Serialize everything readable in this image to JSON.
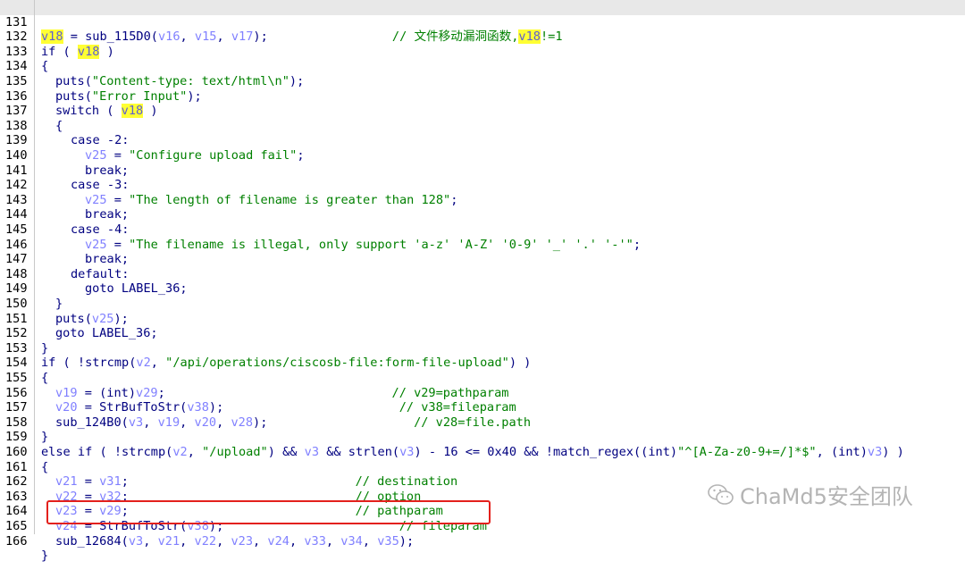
{
  "code": {
    "line_numbers": [
      "131",
      "132",
      "133",
      "134",
      "135",
      "136",
      "137",
      "138",
      "139",
      "140",
      "141",
      "142",
      "143",
      "144",
      "145",
      "146",
      "147",
      "148",
      "149",
      "150",
      "151",
      "152",
      "153",
      "154",
      "155",
      "156",
      "157",
      "158",
      "159",
      "160",
      "161",
      "162",
      "163",
      "164",
      "165",
      "166"
    ],
    "l131": {
      "v18": "v18",
      "assign": " = sub_115D0(",
      "v16": "v16",
      ", ": ", ",
      "v15": "v15",
      "v17": "v17",
      "close": ");",
      "pad": "                 ",
      "comment": "// 文件移动漏洞函数,",
      "v18b": "v18",
      "tail": "!=1"
    },
    "l132": {
      "pre": "if ( ",
      "v18": "v18",
      "post": " )"
    },
    "l133": "{",
    "l134": {
      "pre": "puts(",
      "str": "\"Content-type: text/html\\n\"",
      "post": ");"
    },
    "l135": {
      "pre": "puts(",
      "str": "\"Error Input\"",
      "post": ");"
    },
    "l136": {
      "pre": "switch ( ",
      "v18": "v18",
      "post": " )"
    },
    "l137": "{",
    "l138": "case -2:",
    "l139": {
      "var": "v25",
      "mid": " = ",
      "str": "\"Configure upload fail\"",
      "post": ";"
    },
    "l140": "break;",
    "l141": "case -3:",
    "l142": {
      "var": "v25",
      "mid": " = ",
      "str": "\"The length of filename is greater than 128\"",
      "post": ";"
    },
    "l143": "break;",
    "l144": "case -4:",
    "l145": {
      "var": "v25",
      "mid": " = ",
      "str": "\"The filename is illegal, only support 'a-z' 'A-Z' '0-9' '_' '.' '-'\"",
      "post": ";"
    },
    "l146": "break;",
    "l147": "default:",
    "l148": "goto LABEL_36;",
    "l149": "}",
    "l150": {
      "pre": "puts(",
      "var": "v25",
      "post": ");"
    },
    "l151": "goto LABEL_36;",
    "l152": "}",
    "l153": {
      "pre": "if ( !strcmp(",
      "var": "v2",
      "mid": ", ",
      "str": "\"/api/operations/ciscosb-file:form-file-upload\"",
      "post": ") )"
    },
    "l154": "{",
    "l155": {
      "var": "v19",
      "mid": " = (int)",
      "var2": "v29",
      "post": ";",
      "pad": "                               ",
      "comment": "// v29=pathparam"
    },
    "l156": {
      "var": "v20",
      "mid": " = StrBufToStr(",
      "var2": "v38",
      "post": ");",
      "pad": "                        ",
      "comment": "// v38=fileparam"
    },
    "l157": {
      "pre": "sub_124B0(",
      "a": "v3",
      "b": "v19",
      "c": "v20",
      "d": "v28",
      "post": ");",
      "pad": "                    ",
      "comment": "// v28=file.path"
    },
    "l158": "}",
    "l159": {
      "pre": "else if ( !strcmp(",
      "var": "v2",
      "mid": ", ",
      "str": "\"/upload\"",
      "mid2": ") && ",
      "var2": "v3",
      "mid3": " && strlen(",
      "var3": "v3",
      "mid4": ") - 16 <= 0x40 && !match_regex((int)",
      "str2": "\"^[A-Za-z0-9+=/]*$\"",
      "mid5": ", (int)",
      "var4": "v3",
      "post": ") )"
    },
    "l160": "{",
    "l161": {
      "var": "v21",
      "mid": " = ",
      "var2": "v31",
      "post": ";",
      "pad": "                               ",
      "comment": "// destination"
    },
    "l162": {
      "var": "v22",
      "mid": " = ",
      "var2": "v32",
      "post": ";",
      "pad": "                               ",
      "comment": "// option"
    },
    "l163": {
      "var": "v23",
      "mid": " = ",
      "var2": "v29",
      "post": ";",
      "pad": "                               ",
      "comment": "// pathparam"
    },
    "l164": {
      "var": "v24",
      "mid": " = StrBufToStr(",
      "var2": "v38",
      "post": ");",
      "pad": "                        ",
      "comment": "// fileparam"
    },
    "l165": {
      "pre": "sub_12684(",
      "args": [
        "v3",
        "v21",
        "v22",
        "v23",
        "v24",
        "v33",
        "v34",
        "v35"
      ],
      "post": ");"
    },
    "l166": "}"
  },
  "watermark": {
    "text": "ChaMd5安全团队",
    "icon": "wechat-icon"
  },
  "colors": {
    "keyword": "#000080",
    "variable": "#8080ff",
    "string": "#008000",
    "highlight": "#ffff33",
    "box": "#e3201c"
  }
}
